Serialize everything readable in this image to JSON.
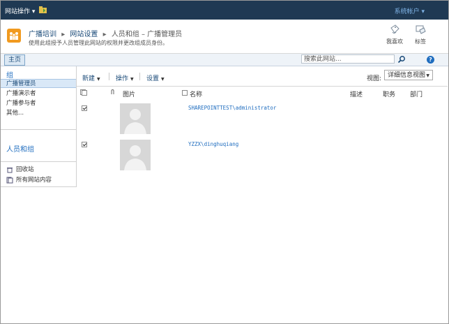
{
  "topbar": {
    "site_actions": "网站操作 ▾",
    "user_menu": "系统帐户 ▾"
  },
  "header": {
    "breadcrumb": [
      "广播培训",
      "网站设置",
      "人员和组 – 广播管理员"
    ],
    "description": "使用此组授予人员管理此网站的权限并更改组成员身份。",
    "like_label": "我喜欢",
    "tags_label": "标签"
  },
  "navbar": {
    "home_tab": "主页",
    "search_placeholder": "搜索此网站...",
    "help": "?"
  },
  "left_nav": {
    "group_heading": "组",
    "groups": [
      "广播管理员",
      "广播演示者",
      "广播参与者",
      "其他..."
    ],
    "people_heading": "人员和组",
    "quick_links": [
      "回收站",
      "所有网站内容"
    ]
  },
  "toolbar": {
    "new": "新建",
    "actions": "操作",
    "settings": "设置",
    "view_label": "视图:",
    "view_value": "详细信息视图"
  },
  "columns": {
    "picture": "图片",
    "name": "名称",
    "about": "描述",
    "title": "职务",
    "department": "部门"
  },
  "rows": [
    {
      "name": "SHAREPOINTTEST\\administrator",
      "checked": true
    },
    {
      "name": "YZZX\\dinghuqiang",
      "checked": true
    }
  ],
  "colors": {
    "topbar": "#1f3953",
    "link": "#1f6dbf",
    "logo": "#f19a1f"
  }
}
